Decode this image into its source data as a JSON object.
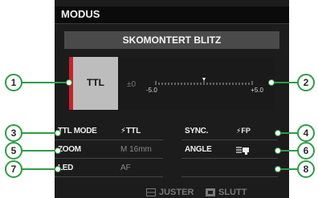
{
  "header": {
    "mode_title": "MODUS"
  },
  "flash": {
    "title": "SKOMONTERT BLITZ",
    "mode": "TTL",
    "compensation": "±0",
    "scale": {
      "min": "-5.0",
      "max": "+5.0",
      "current": 0
    }
  },
  "settings": {
    "ttl_mode": {
      "label": "TTL MODE",
      "value": "⚡TTL"
    },
    "sync": {
      "label": "SYNC.",
      "value": "⚡FP"
    },
    "zoom": {
      "label": "ZOOM",
      "value": "M 16mm"
    },
    "angle": {
      "label": "ANGLE",
      "icon": "flash-angle-icon"
    },
    "led": {
      "label": "LED",
      "value": "AF"
    }
  },
  "footer": {
    "adjust_label": "JUSTER",
    "exit_label": "SLUTT"
  },
  "callouts": [
    "1",
    "2",
    "3",
    "4",
    "5",
    "6",
    "7",
    "8"
  ],
  "colors": {
    "accent_red": "#c8222a",
    "callout_green": "#2f9c47",
    "screen_bg": "#1c1c1c"
  }
}
